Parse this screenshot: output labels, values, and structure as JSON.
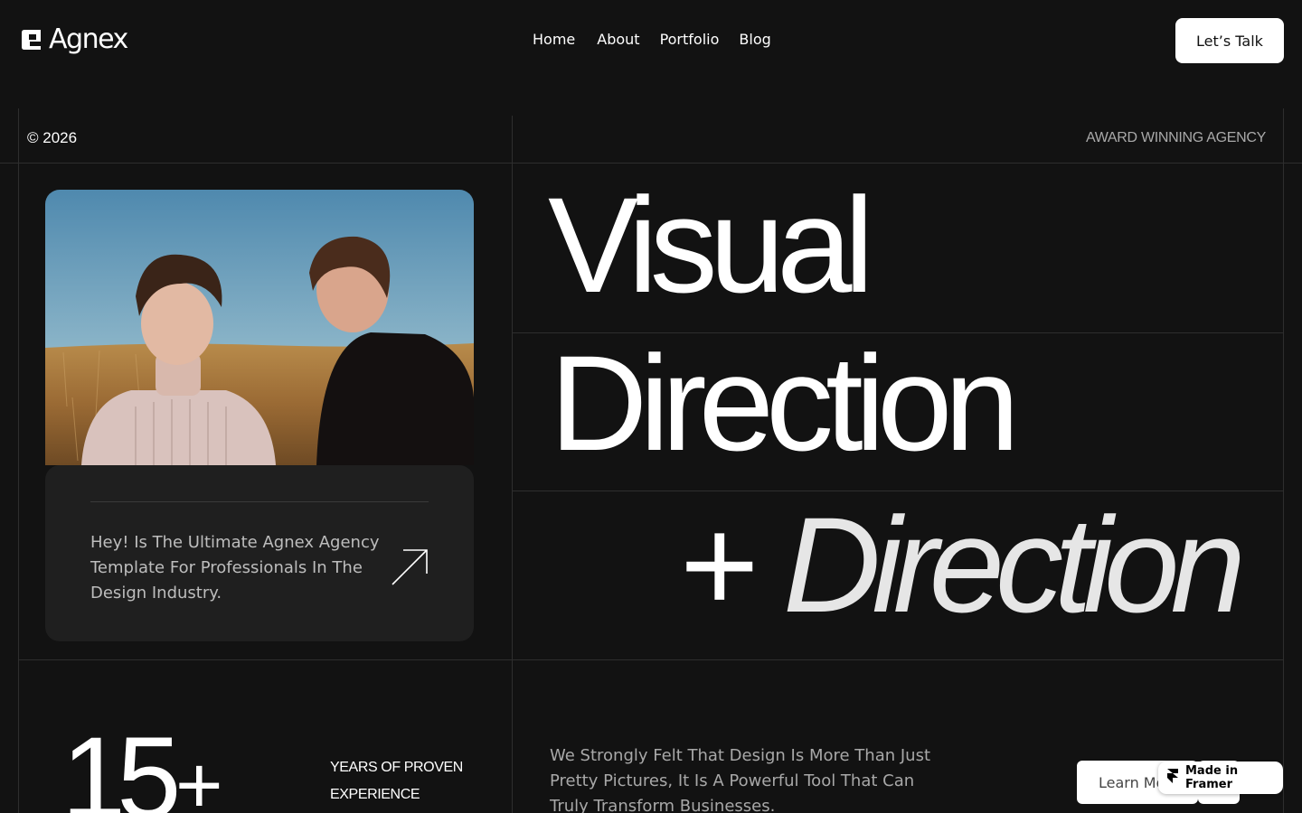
{
  "brand": {
    "name": "Agnex"
  },
  "nav": {
    "items": [
      "Home",
      "About",
      "Portfolio",
      "Blog"
    ]
  },
  "header": {
    "cta_label": "Let’s Talk"
  },
  "meta": {
    "copyright": "© 2026",
    "tagline": "AWARD WINNING AGENCY"
  },
  "hero": {
    "line1": "Visual",
    "line2": "Direction",
    "line3_prefix": "+",
    "line3_italic": "Direction",
    "intro": "Hey! Is The Ultimate Agnex Agency Template For Professionals In The Design Industry."
  },
  "stats": {
    "value": "15",
    "suffix": "+",
    "label": "YEARS OF PROVEN EXPERIENCE"
  },
  "about": {
    "text": "We Strongly Felt That Design Is More Than Just Pretty Pictures, It Is A Powerful Tool That Can Truly Transform Businesses.",
    "button_label": "Learn More"
  },
  "badge": {
    "label": "Made in Framer"
  },
  "colors": {
    "background": "#121212",
    "card": "#1f1f1f",
    "accent": "#ffffff",
    "muted": "#a8a8a8"
  }
}
